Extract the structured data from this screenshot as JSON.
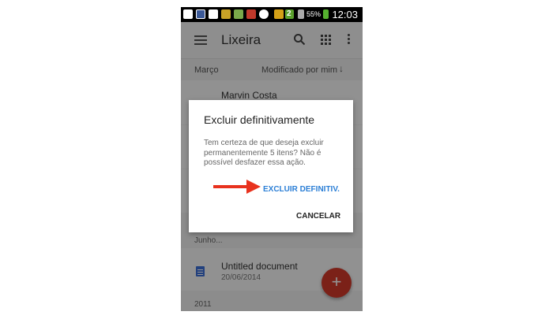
{
  "statusbar": {
    "time": "12:03",
    "battery": "55%",
    "badge": "2"
  },
  "appbar": {
    "title": "Lixeira"
  },
  "sortbar": {
    "section": "Março",
    "sort_label": "Modificado por mim"
  },
  "list": {
    "rows": [
      {
        "name": "Marvin Costa"
      }
    ],
    "section_june": "Junho...",
    "doc_row": {
      "name": "Untitled document",
      "date": "20/06/2014"
    },
    "section_year": "2011"
  },
  "dialog": {
    "title": "Excluir definitivamente",
    "message": "Tem certeza de que deseja excluir permanentemente 5 itens? Não é possível desfazer essa ação.",
    "confirm_label": "EXCLUIR DEFINITIV.",
    "cancel_label": "CANCELAR"
  },
  "fab": {
    "label": "+"
  },
  "colors": {
    "accent": "#2c7fd6",
    "fab": "#d5392a",
    "annotation_arrow": "#e8321e"
  },
  "icons": {
    "menu": "hamburger-icon",
    "search": "search-icon",
    "grid": "grid-view-icon",
    "more": "more-vert-icon",
    "sort_arrow": "arrow-down-icon",
    "folder": "folder-icon",
    "doc": "document-icon"
  }
}
